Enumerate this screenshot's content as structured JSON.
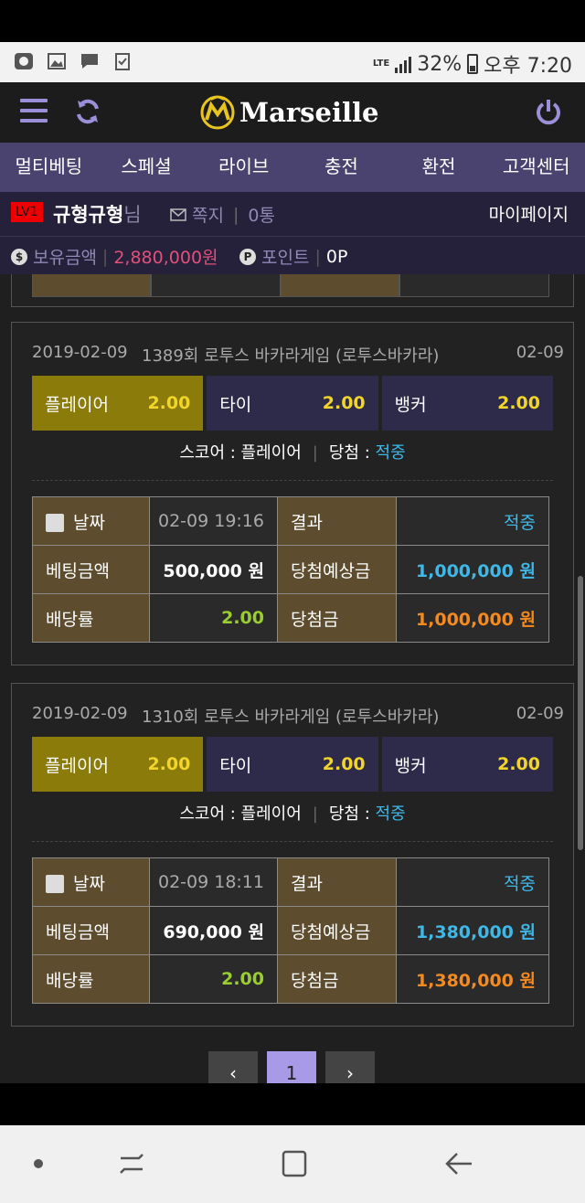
{
  "status": {
    "network": "LTE",
    "battery": "32%",
    "time": "오후 7:20"
  },
  "header": {
    "logo_text": "Marseille"
  },
  "nav": [
    {
      "label": "멀티베팅"
    },
    {
      "label": "스페셜"
    },
    {
      "label": "라이브"
    },
    {
      "label": "충전"
    },
    {
      "label": "환전"
    },
    {
      "label": "고객센터"
    }
  ],
  "user": {
    "level": "LV1",
    "name": "규형규형",
    "suffix": "님",
    "message_label": "쪽지",
    "message_count": "0통",
    "mypage": "마이페이지"
  },
  "balance": {
    "money_label": "보유금액",
    "money_value": "2,880,000원",
    "point_label": "포인트",
    "point_value": "0P"
  },
  "cards": [
    {
      "date": "2019-02-09",
      "title": "1389회 로투스 바카라게임 (로투스바카라)",
      "short_date": "02-09",
      "odds": [
        {
          "name": "플레이어",
          "value": "2.00"
        },
        {
          "name": "타이",
          "value": "2.00"
        },
        {
          "name": "뱅커",
          "value": "2.00"
        }
      ],
      "score_label": "스코어 : 플레이어",
      "result_label": "당첨 : ",
      "result_value": "적중",
      "table": {
        "date_label": "날짜",
        "date_value": "02-09 19:16",
        "result_label": "결과",
        "result_value": "적중",
        "bet_label": "베팅금액",
        "bet_value": "500,000 원",
        "expected_label": "당첨예상금",
        "expected_value": "1,000,000 원",
        "rate_label": "배당률",
        "rate_value": "2.00",
        "win_label": "당첨금",
        "win_value": "1,000,000 원"
      }
    },
    {
      "date": "2019-02-09",
      "title": "1310회 로투스 바카라게임 (로투스바카라)",
      "short_date": "02-09",
      "odds": [
        {
          "name": "플레이어",
          "value": "2.00"
        },
        {
          "name": "타이",
          "value": "2.00"
        },
        {
          "name": "뱅커",
          "value": "2.00"
        }
      ],
      "score_label": "스코어 : 플레이어",
      "result_label": "당첨 : ",
      "result_value": "적중",
      "table": {
        "date_label": "날짜",
        "date_value": "02-09 18:11",
        "result_label": "결과",
        "result_value": "적중",
        "bet_label": "베팅금액",
        "bet_value": "690,000 원",
        "expected_label": "당첨예상금",
        "expected_value": "1,380,000 원",
        "rate_label": "배당률",
        "rate_value": "2.00",
        "win_label": "당첨금",
        "win_value": "1,380,000 원"
      }
    }
  ],
  "pagination": {
    "prev": "‹",
    "current": "1",
    "next": "›"
  }
}
